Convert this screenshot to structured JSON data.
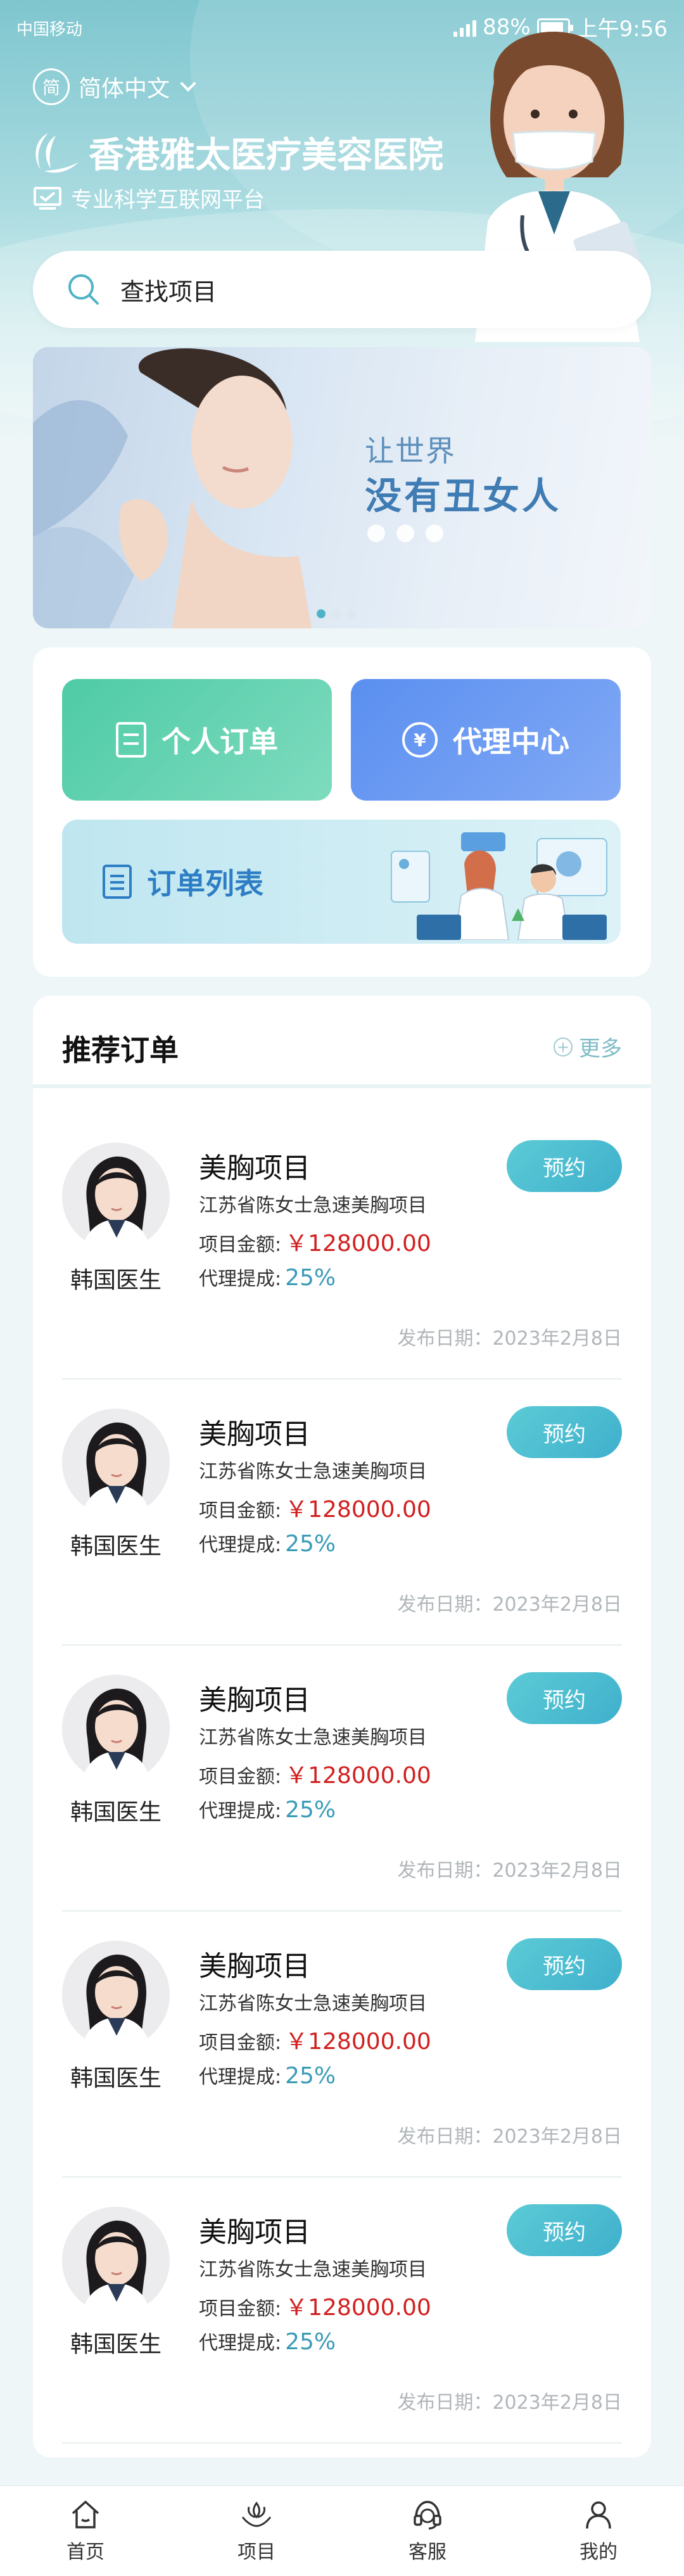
{
  "status_bar": {
    "carrier": "中国移动",
    "battery": "88%",
    "time": "上午9:56"
  },
  "header": {
    "lang_badge": "简",
    "lang_label": "简体中文",
    "title": "香港雅太医疗美容医院",
    "slogan": "专业科学互联网平台"
  },
  "search": {
    "placeholder": "查找项目"
  },
  "banner": {
    "line1": "让世界",
    "line2": "没有丑女人",
    "slide_count": 3,
    "active_slide": 0
  },
  "quick": {
    "personal_orders": "个人订单",
    "agent_center": "代理中心",
    "agent_icon": "¥",
    "order_list": "订单列表"
  },
  "recommend": {
    "title": "推荐订单",
    "more": "更多",
    "reserve_label": "预约",
    "amount_label": "项目金额:",
    "commission_label": "代理提成:",
    "orders": [
      {
        "doctor": "韩国医生",
        "title": "美胸项目",
        "desc": "江苏省陈女士急速美胸项目",
        "amount": "￥128000.00",
        "commission": "25%",
        "date": "发布日期：2023年2月8日"
      },
      {
        "doctor": "韩国医生",
        "title": "美胸项目",
        "desc": "江苏省陈女士急速美胸项目",
        "amount": "￥128000.00",
        "commission": "25%",
        "date": "发布日期：2023年2月8日"
      },
      {
        "doctor": "韩国医生",
        "title": "美胸项目",
        "desc": "江苏省陈女士急速美胸项目",
        "amount": "￥128000.00",
        "commission": "25%",
        "date": "发布日期：2023年2月8日"
      },
      {
        "doctor": "韩国医生",
        "title": "美胸项目",
        "desc": "江苏省陈女士急速美胸项目",
        "amount": "￥128000.00",
        "commission": "25%",
        "date": "发布日期：2023年2月8日"
      },
      {
        "doctor": "韩国医生",
        "title": "美胸项目",
        "desc": "江苏省陈女士急速美胸项目",
        "amount": "￥128000.00",
        "commission": "25%",
        "date": "发布日期：2023年2月8日"
      }
    ]
  },
  "tabbar": {
    "items": [
      "首页",
      "项目",
      "客服",
      "我的"
    ]
  },
  "colors": {
    "primary": "#4fb3c6",
    "amount_red": "#d21f1f",
    "commission_blue": "#3a9cb7",
    "green_btn": "#4ecba5",
    "blue_btn": "#5a8ff0"
  }
}
